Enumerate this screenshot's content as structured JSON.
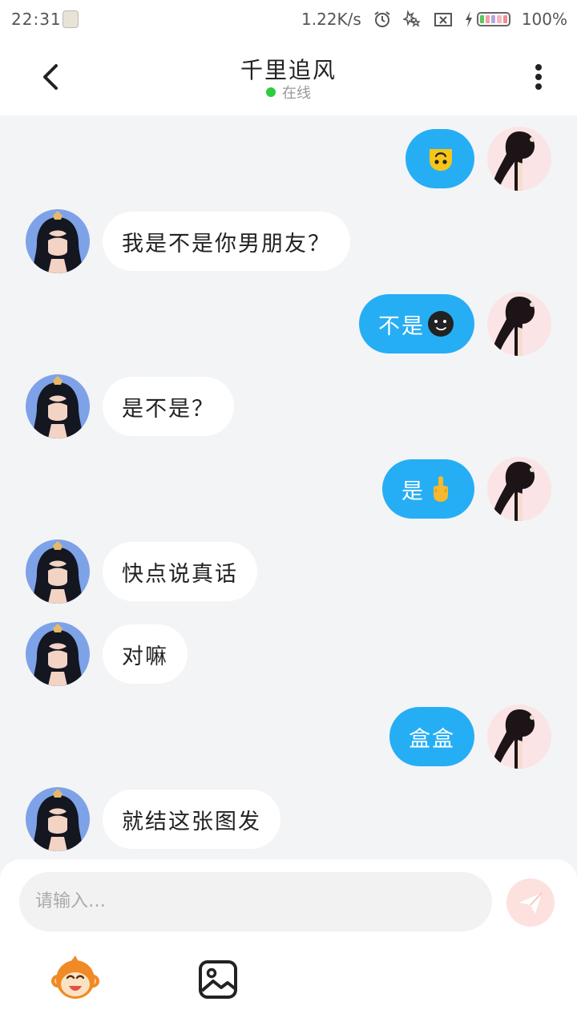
{
  "status_bar": {
    "time": "22:31",
    "net_speed": "1.22K/s",
    "battery_pct": "100%",
    "icons": [
      "notification-icon",
      "alarm-icon",
      "dnd-icon",
      "sim-x-icon",
      "charging-icon",
      "battery-icon"
    ]
  },
  "header": {
    "title": "千里追风",
    "status": "在线",
    "status_color": "#2ecc40",
    "icons": [
      "back-chevron-icon",
      "more-vert-icon"
    ]
  },
  "messages": [
    {
      "side": "right",
      "text": "",
      "emoji": "upside-down-face-icon"
    },
    {
      "side": "left",
      "text": "我是不是你男朋友？",
      "emoji": ""
    },
    {
      "side": "right",
      "text": "不是",
      "emoji": "new-moon-face-icon"
    },
    {
      "side": "left",
      "text": "是不是？",
      "emoji": ""
    },
    {
      "side": "right",
      "text": "是",
      "emoji": "middle-finger-icon"
    },
    {
      "side": "left",
      "text": "快点说真话",
      "emoji": ""
    },
    {
      "side": "left",
      "text": "对嘛",
      "emoji": ""
    },
    {
      "side": "right",
      "text": "盒盒",
      "emoji": ""
    },
    {
      "side": "left",
      "text": "就结这张图发",
      "emoji": ""
    }
  ],
  "input": {
    "placeholder": "请输入…",
    "send_icon": "send-plane-icon"
  },
  "toolbar": {
    "icons": [
      "monkey-sticker-icon",
      "image-picker-icon"
    ]
  },
  "colors": {
    "accent": "#26aef5",
    "chat_bg": "#f3f4f6",
    "send_disabled": "#fde1de"
  }
}
